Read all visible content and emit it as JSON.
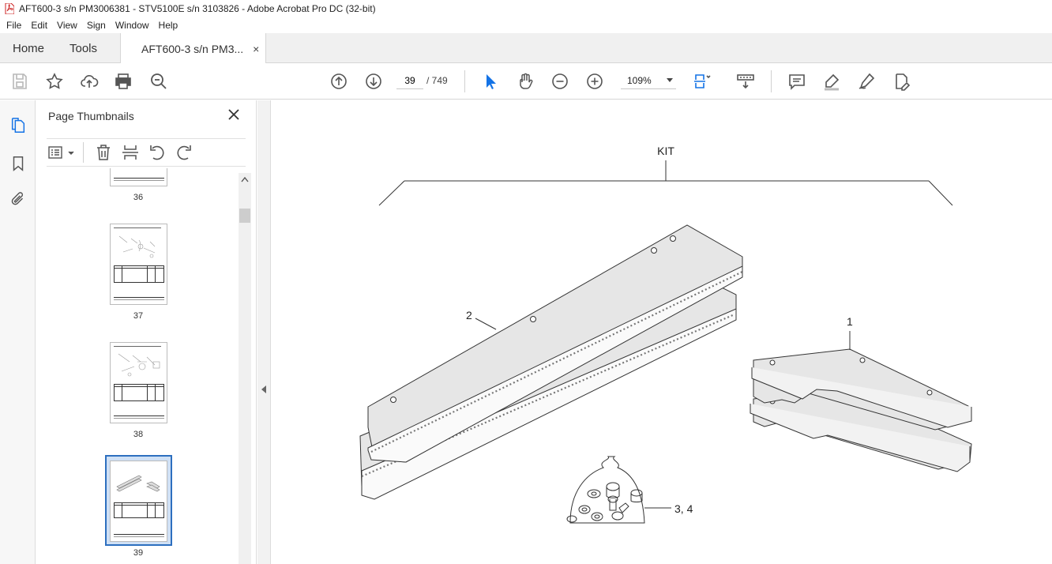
{
  "window": {
    "title": "AFT600-3 s/n PM3006381 - STV5100E s/n 3103826 - Adobe Acrobat Pro DC (32-bit)"
  },
  "menu": [
    "File",
    "Edit",
    "View",
    "Sign",
    "Window",
    "Help"
  ],
  "tabs": {
    "home": "Home",
    "tools": "Tools",
    "document": "AFT600-3 s/n PM3...",
    "close_glyph": "×"
  },
  "toolbar": {
    "current_page": "39",
    "page_total": "/   749",
    "zoom": "109%",
    "icons": [
      "save-icon",
      "star-icon",
      "upload-icon",
      "print-icon",
      "search-icon",
      "page-up-icon",
      "page-down-icon",
      "select-arrow-icon",
      "hand-icon",
      "zoom-out-icon",
      "zoom-in-icon",
      "fit-page-icon",
      "scroll-mode-icon",
      "comment-icon",
      "highlight-icon",
      "sign-icon",
      "edit-icon"
    ]
  },
  "sidebar": {
    "title": "Page Thumbnails",
    "thumbnails": [
      {
        "label": "36"
      },
      {
        "label": "37"
      },
      {
        "label": "38"
      },
      {
        "label": "39",
        "selected": true
      }
    ]
  },
  "drawing": {
    "kit_label": "KIT",
    "callouts": [
      "2",
      "1",
      "3, 4"
    ]
  },
  "colors": {
    "accent": "#1473e6",
    "selection": "#2d6fbf",
    "part_fill": "#e6e6e6"
  }
}
